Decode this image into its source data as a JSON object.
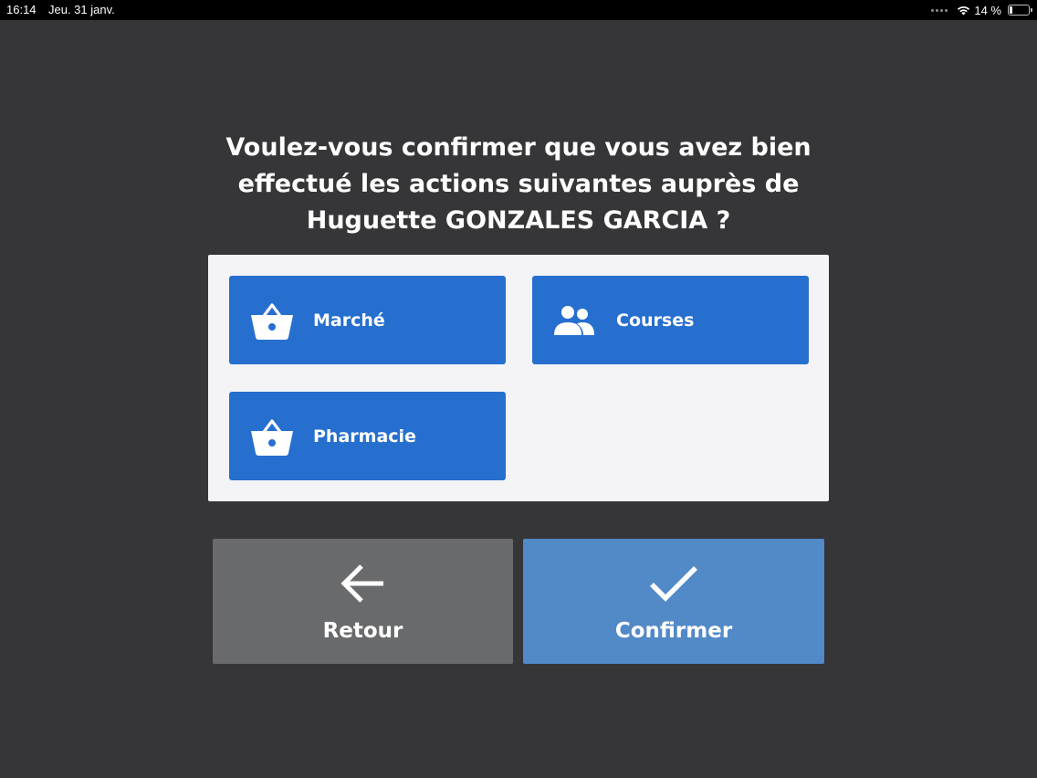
{
  "status_bar": {
    "time": "16:14",
    "date": "Jeu. 31 janv.",
    "battery": "14 %"
  },
  "question": {
    "line1": "Voulez-vous confirmer que vous avez bien",
    "line2": "effectué les actions suivantes auprès de",
    "line3": "Huguette GONZALES GARCIA ?"
  },
  "actions": [
    {
      "label": "Marché",
      "icon": "basket-icon"
    },
    {
      "label": "Courses",
      "icon": "people-icon"
    },
    {
      "label": "Pharmacie",
      "icon": "basket-icon"
    }
  ],
  "buttons": {
    "back_label": "Retour",
    "back_icon": "arrow-left-icon",
    "confirm_label": "Confirmer",
    "confirm_icon": "checkmark-icon"
  },
  "colors": {
    "background": "#363537",
    "panel": "#f4f3f6",
    "action_card": "#266fcf",
    "back_button": "#696a6c",
    "confirm_button": "#5289c7"
  }
}
